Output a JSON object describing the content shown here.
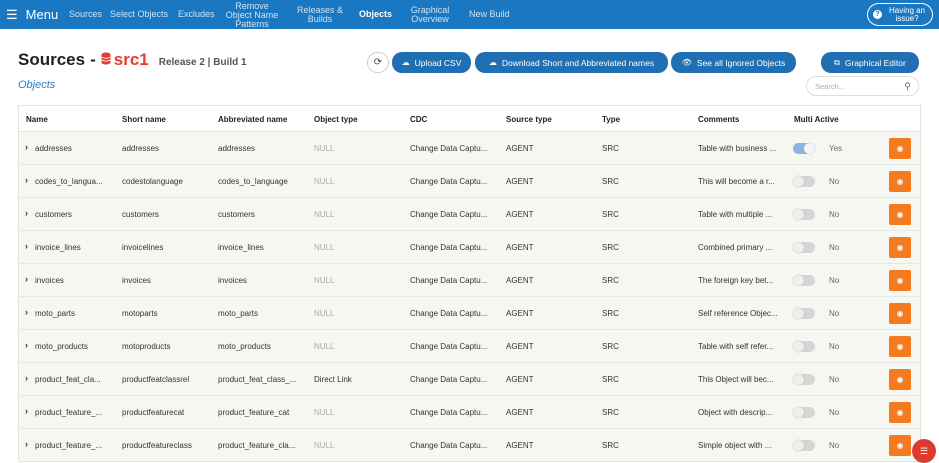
{
  "nav": {
    "menu_label": "Menu",
    "items": [
      {
        "label": "Sources"
      },
      {
        "label": "Select Objects"
      },
      {
        "label": "Excludes"
      },
      {
        "label": "Remove Object Name Patterns"
      },
      {
        "label": "Releases & Builds"
      },
      {
        "label": "Objects"
      },
      {
        "label": "Graphical Overview"
      },
      {
        "label": "New Build"
      }
    ],
    "active": "Objects",
    "issue_label": "Having an issue?"
  },
  "header": {
    "title": "Sources",
    "source_name": "src1",
    "release": "Release 2 | Build 1",
    "subtitle": "Objects"
  },
  "toolbar": {
    "upload_csv": "Upload CSV",
    "download_names": "Download Short and Abbreviated names",
    "see_ignored": "See all Ignored Objects",
    "graphical_editor": "Graphical Editor"
  },
  "search": {
    "placeholder": "Search..."
  },
  "table": {
    "columns": [
      "Name",
      "Short name",
      "Abbreviated name",
      "Object type",
      "CDC",
      "Source type",
      "Type",
      "Comments",
      "Multi Active"
    ],
    "rows": [
      {
        "name": "addresses",
        "short": "addresses",
        "abbr": "addresses",
        "objtype": "NULL",
        "cdc": "Change Data Captu...",
        "source_type": "AGENT",
        "type": "SRC",
        "comments": "Table with business ...",
        "multi_active": "Yes"
      },
      {
        "name": "codes_to_langua...",
        "short": "codestolanguage",
        "abbr": "codes_to_language",
        "objtype": "NULL",
        "cdc": "Change Data Captu...",
        "source_type": "AGENT",
        "type": "SRC",
        "comments": "This will become a r...",
        "multi_active": "No"
      },
      {
        "name": "customers",
        "short": "customers",
        "abbr": "customers",
        "objtype": "NULL",
        "cdc": "Change Data Captu...",
        "source_type": "AGENT",
        "type": "SRC",
        "comments": "Table with multiple ...",
        "multi_active": "No"
      },
      {
        "name": "invoice_lines",
        "short": "invoicelines",
        "abbr": "invoice_lines",
        "objtype": "NULL",
        "cdc": "Change Data Captu...",
        "source_type": "AGENT",
        "type": "SRC",
        "comments": "Combined primary ...",
        "multi_active": "No"
      },
      {
        "name": "invoices",
        "short": "invoices",
        "abbr": "invoices",
        "objtype": "NULL",
        "cdc": "Change Data Captu...",
        "source_type": "AGENT",
        "type": "SRC",
        "comments": "The foreign key bet...",
        "multi_active": "No"
      },
      {
        "name": "moto_parts",
        "short": "motoparts",
        "abbr": "moto_parts",
        "objtype": "NULL",
        "cdc": "Change Data Captu...",
        "source_type": "AGENT",
        "type": "SRC",
        "comments": "Self reference Objec...",
        "multi_active": "No"
      },
      {
        "name": "moto_products",
        "short": "motoproducts",
        "abbr": "moto_products",
        "objtype": "NULL",
        "cdc": "Change Data Captu...",
        "source_type": "AGENT",
        "type": "SRC",
        "comments": "Table with self refer...",
        "multi_active": "No"
      },
      {
        "name": "product_feat_cla...",
        "short": "productfeatclassrel",
        "abbr": "product_feat_class_...",
        "objtype": "Direct Link",
        "cdc": "Change Data Captu...",
        "source_type": "AGENT",
        "type": "SRC",
        "comments": "This Object will bec...",
        "multi_active": "No"
      },
      {
        "name": "product_feature_...",
        "short": "productfeaturecat",
        "abbr": "product_feature_cat",
        "objtype": "NULL",
        "cdc": "Change Data Captu...",
        "source_type": "AGENT",
        "type": "SRC",
        "comments": "Object with descrip...",
        "multi_active": "No"
      },
      {
        "name": "product_feature_...",
        "short": "productfeatureclass",
        "abbr": "product_feature_cla...",
        "objtype": "NULL",
        "cdc": "Change Data Captu...",
        "source_type": "AGENT",
        "type": "SRC",
        "comments": "Simple object with ...",
        "multi_active": "No"
      }
    ]
  },
  "colors": {
    "nav_bg": "#1a78c2",
    "button_blue": "#1f6fb2",
    "accent_red": "#e63b2e",
    "action_orange": "#f47a20"
  }
}
